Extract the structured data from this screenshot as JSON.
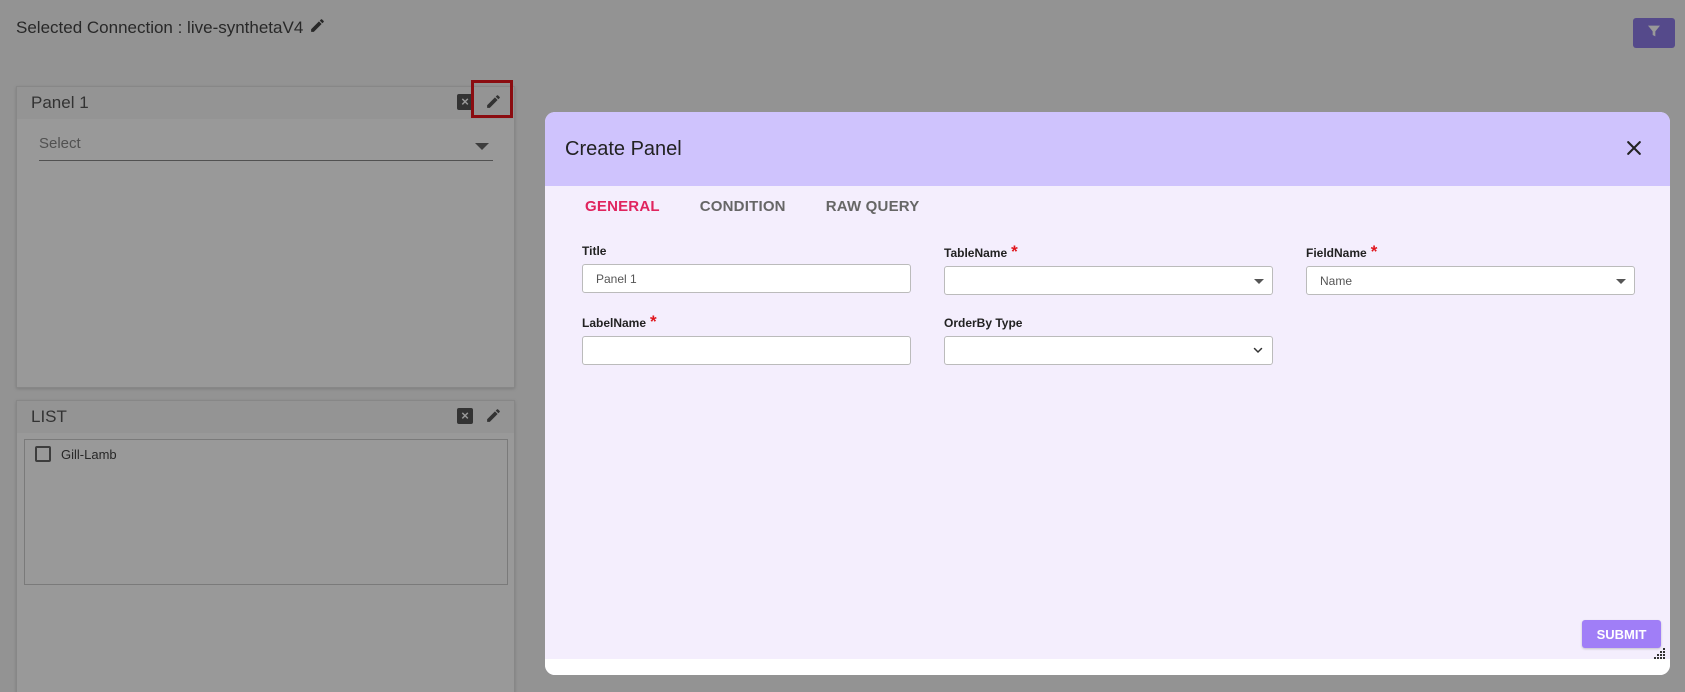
{
  "connection": {
    "label": "Selected Connection : live-synthetaV4"
  },
  "panels": [
    {
      "title": "Panel 1",
      "select_placeholder": "Select"
    },
    {
      "title": "LIST",
      "items": [
        {
          "label": "Gill-Lamb"
        }
      ]
    }
  ],
  "modal": {
    "title": "Create Panel",
    "tabs": [
      {
        "label": "GENERAL",
        "active": true
      },
      {
        "label": "CONDITION"
      },
      {
        "label": "RAW QUERY"
      }
    ],
    "fields": {
      "title": {
        "label": "Title",
        "value": "Panel 1"
      },
      "table_name": {
        "label": "TableName",
        "value": ""
      },
      "field_name": {
        "label": "FieldName",
        "value": "Name"
      },
      "label_name": {
        "label": "LabelName",
        "value": ""
      },
      "order_by_type": {
        "label": "OrderBy Type",
        "value": ""
      }
    },
    "submit_label": "SUBMIT"
  },
  "colors": {
    "accent": "#8e7ce8",
    "modal_header": "#cfc3fd",
    "active_tab": "#e0245e",
    "submit": "#a07ef7",
    "highlight": "#e8141b"
  }
}
